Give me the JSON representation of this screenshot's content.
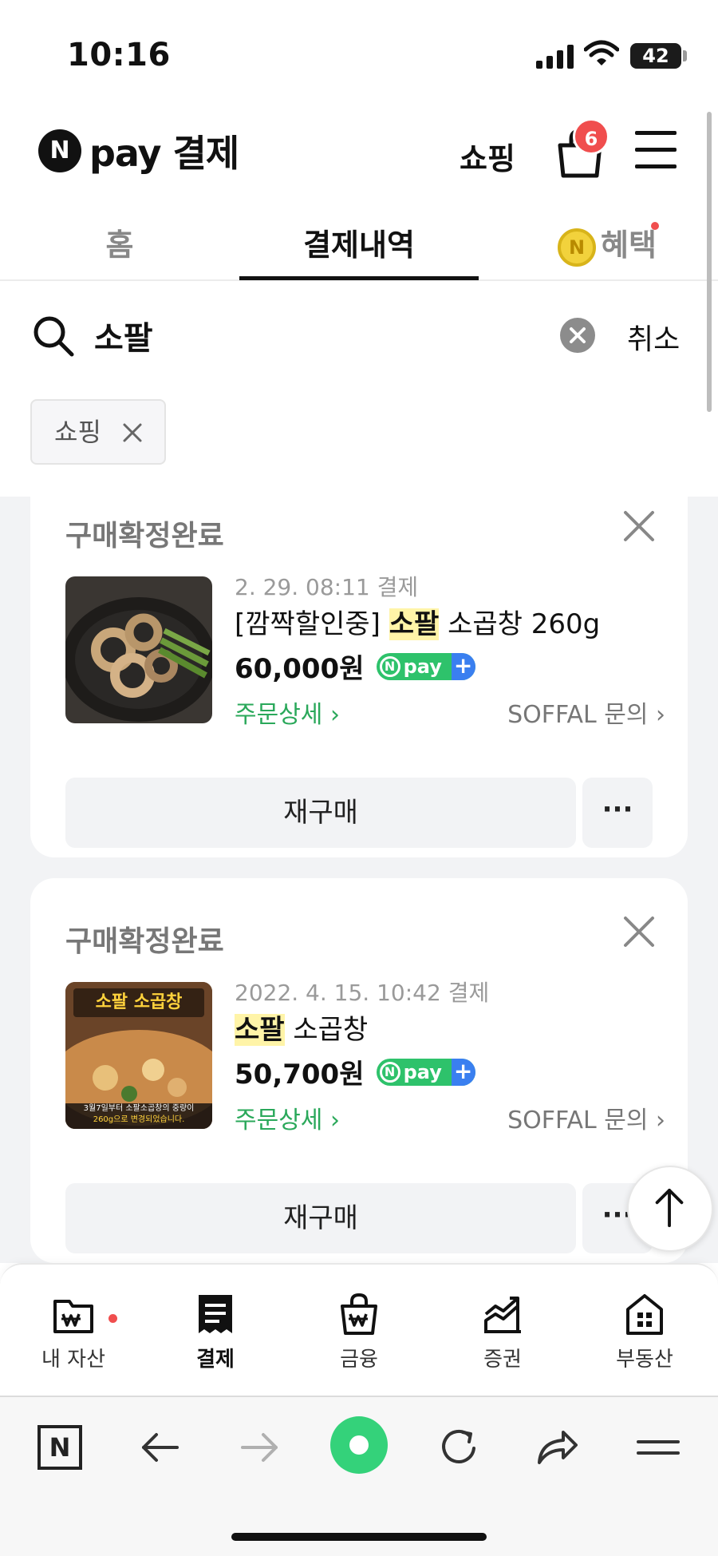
{
  "status_bar": {
    "time": "10:16",
    "battery": "42"
  },
  "header": {
    "logo_mark": "N",
    "logo_text": "pay 결제",
    "shopping_link": "쇼핑",
    "cart_count": "6"
  },
  "tabs": [
    {
      "label": "홈"
    },
    {
      "label": "결제내역",
      "active": true
    },
    {
      "label": "혜택",
      "icon": "coin-icon",
      "coin_mark": "N"
    }
  ],
  "search": {
    "query": "소팔",
    "cancel_label": "취소",
    "filter_chip": "쇼핑"
  },
  "orders": [
    {
      "status": "구매확정완료",
      "date": "2. 29. 08:11 결제",
      "name_prefix": "[깜짝할인중] ",
      "name_highlight": "소팔",
      "name_suffix": " 소곱창 260g",
      "price": "60,000원",
      "npay_badge": "pay",
      "order_detail": "주문상세",
      "seller_inquiry": "SOFFAL 문의",
      "rebuy_label": "재구매",
      "more_label": "···"
    },
    {
      "status": "구매확정완료",
      "date": "2022. 4. 15. 10:42 결제",
      "name_prefix": "",
      "name_highlight": "소팔",
      "name_suffix": " 소곱창",
      "price": "50,700원",
      "npay_badge": "pay",
      "order_detail": "주문상세",
      "seller_inquiry": "SOFFAL 문의",
      "rebuy_label": "재구매",
      "more_label": "···",
      "thumb_title": "소팔 소곱창",
      "thumb_caption_1": "3월7일부터 소팔소곱창의 중량이",
      "thumb_caption_2": "260g으로 변경되었습니다."
    }
  ],
  "bottom_nav": [
    {
      "label": "내 자산",
      "icon": "wallet-folder-icon",
      "has_dot": true
    },
    {
      "label": "결제",
      "icon": "receipt-icon",
      "active": true
    },
    {
      "label": "금융",
      "icon": "bag-won-icon"
    },
    {
      "label": "증권",
      "icon": "chart-icon"
    },
    {
      "label": "부동산",
      "icon": "house-icon"
    }
  ],
  "browser_bar": {
    "home_label": "N"
  },
  "colors": {
    "accent_green": "#2ec26b",
    "badge_red": "#f04e4e",
    "highlight": "#fff4a8",
    "link_green": "#2aa85a"
  }
}
